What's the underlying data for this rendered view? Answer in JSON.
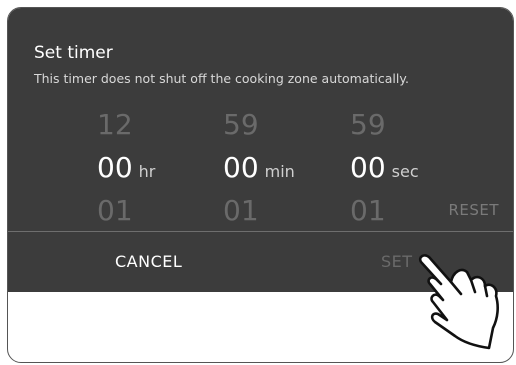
{
  "dialog": {
    "title": "Set timer",
    "subtitle": "This timer does not shut off the cooking zone automatically."
  },
  "picker": {
    "hours": {
      "prev": "12",
      "value": "00",
      "next": "01",
      "unit": "hr"
    },
    "minutes": {
      "prev": "59",
      "value": "00",
      "next": "01",
      "unit": "min"
    },
    "seconds": {
      "prev": "59",
      "value": "00",
      "next": "01",
      "unit": "sec"
    }
  },
  "actions": {
    "reset_label": "RESET",
    "cancel_label": "CANCEL",
    "set_label": "SET"
  },
  "colors": {
    "dialog_bg": "#3c3c3c",
    "text_primary": "#ffffff",
    "text_disabled": "#6a6a6a"
  },
  "icons": {
    "pointer": "tap-hand-icon"
  }
}
